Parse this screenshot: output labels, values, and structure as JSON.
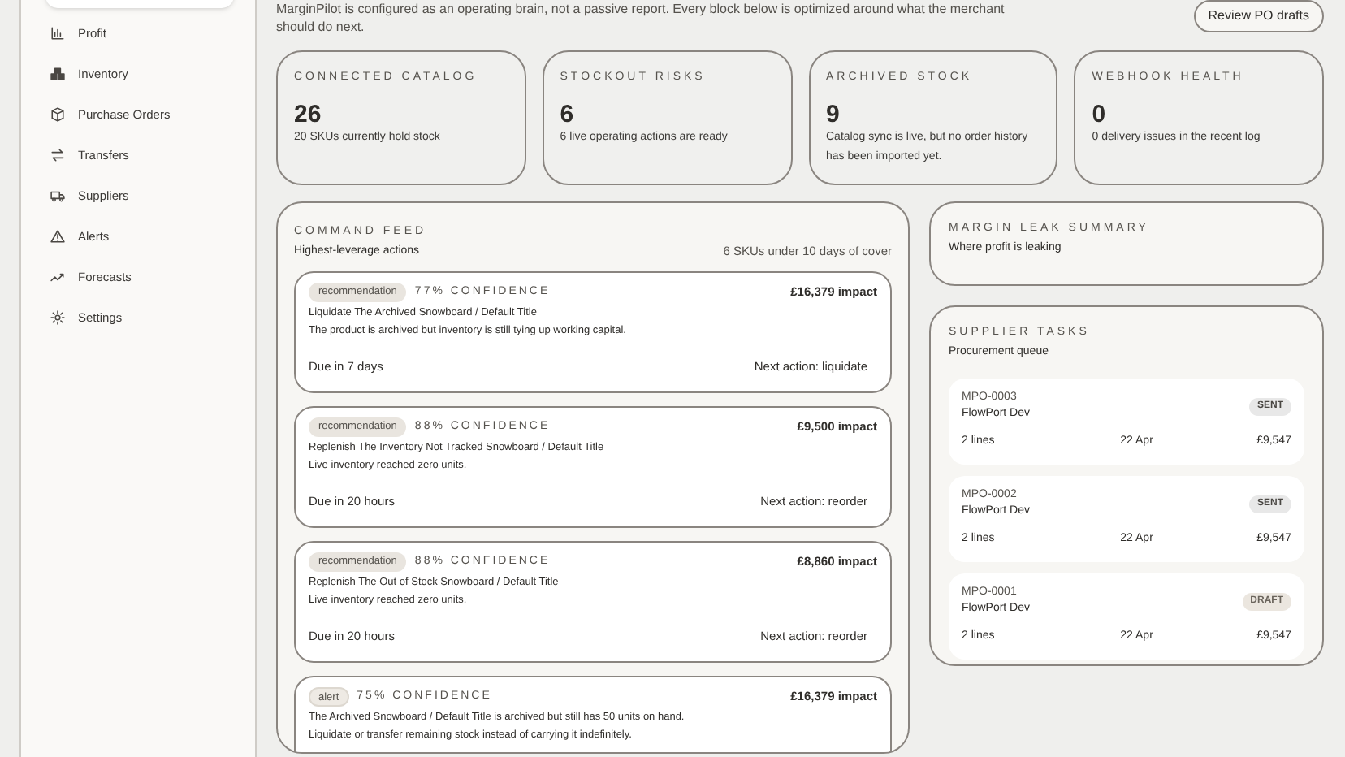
{
  "sidebar": {
    "items": [
      {
        "label": "Profit"
      },
      {
        "label": "Inventory"
      },
      {
        "label": "Purchase Orders"
      },
      {
        "label": "Transfers"
      },
      {
        "label": "Suppliers"
      },
      {
        "label": "Alerts"
      },
      {
        "label": "Forecasts"
      },
      {
        "label": "Settings"
      }
    ]
  },
  "intro": "MarginPilot is configured as an operating brain, not a passive report. Every block below is optimized around what the merchant should do next.",
  "header_button": "Review PO drafts",
  "stats": [
    {
      "label": "CONNECTED CATALOG",
      "value": "26",
      "note": "20 SKUs currently hold stock"
    },
    {
      "label": "STOCKOUT RISKS",
      "value": "6",
      "note": "6 live operating actions are ready"
    },
    {
      "label": "ARCHIVED STOCK",
      "value": "9",
      "note": "Catalog sync is live, but no order history has been imported yet."
    },
    {
      "label": "WEBHOOK HEALTH",
      "value": "0",
      "note": "0 delivery issues in the recent log"
    }
  ],
  "command_feed": {
    "title": "COMMAND FEED",
    "subtitle": "Highest-leverage actions",
    "summary": "6 SKUs under 10 days of cover",
    "items": [
      {
        "tag": "recommendation",
        "confidence": "77% CONFIDENCE",
        "impact": "£16,379 impact",
        "title": "Liquidate The Archived Snowboard / Default Title",
        "detail": "The product is archived but inventory is still tying up working capital.",
        "due": "Due in 7 days",
        "next_action": "Next action: liquidate"
      },
      {
        "tag": "recommendation",
        "confidence": "88% CONFIDENCE",
        "impact": "£9,500 impact",
        "title": "Replenish The Inventory Not Tracked Snowboard / Default Title",
        "detail": "Live inventory reached zero units.",
        "due": "Due in 20 hours",
        "next_action": "Next action: reorder"
      },
      {
        "tag": "recommendation",
        "confidence": "88% CONFIDENCE",
        "impact": "£8,860 impact",
        "title": "Replenish The Out of Stock Snowboard / Default Title",
        "detail": "Live inventory reached zero units.",
        "due": "Due in 20 hours",
        "next_action": "Next action: reorder"
      },
      {
        "tag": "alert",
        "confidence": "75% CONFIDENCE",
        "impact": "£16,379 impact",
        "title": "The Archived Snowboard / Default Title is archived but still has 50 units on hand.",
        "detail": "Liquidate or transfer remaining stock instead of carrying it indefinitely."
      }
    ]
  },
  "margin_leak": {
    "title": "MARGIN LEAK SUMMARY",
    "subtitle": "Where profit is leaking"
  },
  "supplier_tasks": {
    "title": "SUPPLIER TASKS",
    "subtitle": "Procurement queue",
    "orders": [
      {
        "id": "MPO-0003",
        "supplier": "FlowPort Dev",
        "status": "SENT",
        "lines": "2 lines",
        "date": "22 Apr",
        "total": "£9,547"
      },
      {
        "id": "MPO-0002",
        "supplier": "FlowPort Dev",
        "status": "SENT",
        "lines": "2 lines",
        "date": "22 Apr",
        "total": "£9,547"
      },
      {
        "id": "MPO-0001",
        "supplier": "FlowPort Dev",
        "status": "DRAFT",
        "lines": "2 lines",
        "date": "22 Apr",
        "total": "£9,547"
      }
    ]
  }
}
